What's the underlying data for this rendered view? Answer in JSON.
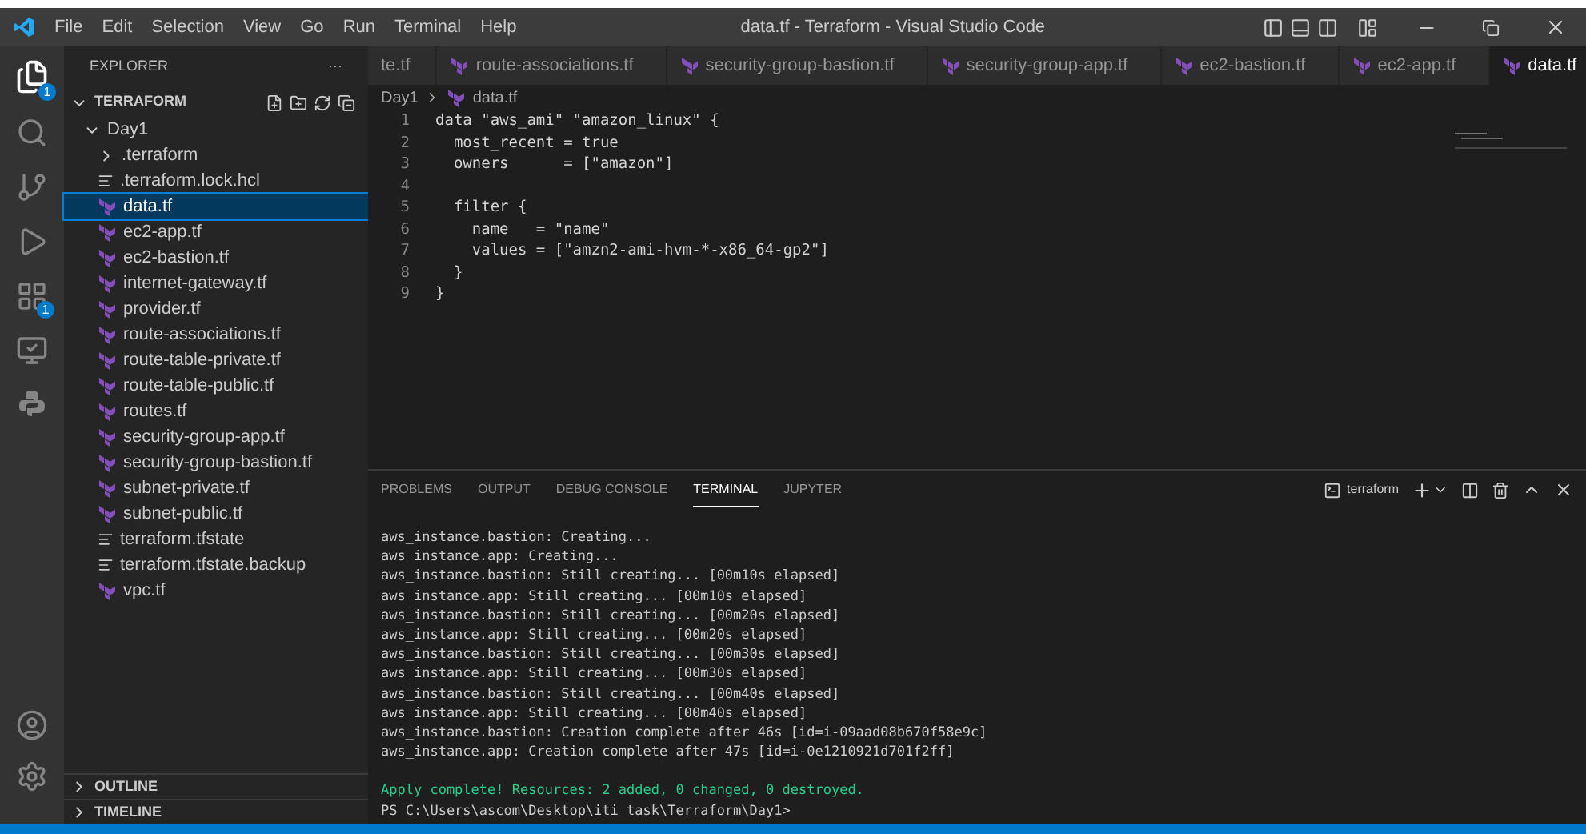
{
  "window": {
    "title": "data.tf - Terraform - Visual Studio Code"
  },
  "menu": [
    "File",
    "Edit",
    "Selection",
    "View",
    "Go",
    "Run",
    "Terminal",
    "Help"
  ],
  "activity_badges": {
    "explorer": "1",
    "extensions": "1"
  },
  "sidebar": {
    "title": "EXPLORER",
    "more": "···",
    "root": {
      "label": "TERRAFORM",
      "expanded": true,
      "children": [
        {
          "label": "Day1",
          "kind": "folder",
          "expanded": true,
          "selected": false,
          "children": [
            {
              "label": ".terraform",
              "kind": "folder",
              "expanded": false,
              "selected": false
            },
            {
              "label": ".terraform.lock.hcl",
              "kind": "text",
              "selected": false
            },
            {
              "label": "data.tf",
              "kind": "tf",
              "selected": true
            },
            {
              "label": "ec2-app.tf",
              "kind": "tf",
              "selected": false
            },
            {
              "label": "ec2-bastion.tf",
              "kind": "tf",
              "selected": false
            },
            {
              "label": "internet-gateway.tf",
              "kind": "tf",
              "selected": false
            },
            {
              "label": "provider.tf",
              "kind": "tf",
              "selected": false
            },
            {
              "label": "route-associations.tf",
              "kind": "tf",
              "selected": false
            },
            {
              "label": "route-table-private.tf",
              "kind": "tf",
              "selected": false
            },
            {
              "label": "route-table-public.tf",
              "kind": "tf",
              "selected": false
            },
            {
              "label": "routes.tf",
              "kind": "tf",
              "selected": false
            },
            {
              "label": "security-group-app.tf",
              "kind": "tf",
              "selected": false
            },
            {
              "label": "security-group-bastion.tf",
              "kind": "tf",
              "selected": false
            },
            {
              "label": "subnet-private.tf",
              "kind": "tf",
              "selected": false
            },
            {
              "label": "subnet-public.tf",
              "kind": "tf",
              "selected": false
            },
            {
              "label": "terraform.tfstate",
              "kind": "text",
              "selected": false
            },
            {
              "label": "terraform.tfstate.backup",
              "kind": "text",
              "selected": false
            },
            {
              "label": "vpc.tf",
              "kind": "tf",
              "selected": false
            }
          ]
        }
      ]
    },
    "sections": [
      {
        "label": "OUTLINE",
        "expanded": false
      },
      {
        "label": "TIMELINE",
        "expanded": false
      }
    ]
  },
  "tabs": [
    {
      "label": "te.tf",
      "selected": false,
      "kind": "plain"
    },
    {
      "label": "route-associations.tf",
      "selected": false,
      "kind": "tf"
    },
    {
      "label": "security-group-bastion.tf",
      "selected": false,
      "kind": "tf"
    },
    {
      "label": "security-group-app.tf",
      "selected": false,
      "kind": "tf"
    },
    {
      "label": "ec2-bastion.tf",
      "selected": false,
      "kind": "tf"
    },
    {
      "label": "ec2-app.tf",
      "selected": false,
      "kind": "tf"
    },
    {
      "label": "data.tf",
      "selected": true,
      "kind": "tf"
    }
  ],
  "breadcrumb": [
    "Day1",
    "data.tf"
  ],
  "code": [
    {
      "line": "1",
      "text": "data \"aws_ami\" \"amazon_linux\" {"
    },
    {
      "line": "2",
      "text": "  most_recent = true"
    },
    {
      "line": "3",
      "text": "  owners      = [\"amazon\"]"
    },
    {
      "line": "4"
    },
    {
      "line": "5",
      "text": "  filter {"
    },
    {
      "line": "6",
      "text": "    name   = \"name\""
    },
    {
      "line": "7",
      "text": "    values = [\"amzn2-ami-hvm-*-x86_64-gp2\"]"
    },
    {
      "line": "8",
      "text": "  }"
    },
    {
      "line": "9",
      "text": "}"
    }
  ],
  "panel": {
    "tabs": [
      {
        "label": "PROBLEMS",
        "selected": false
      },
      {
        "label": "OUTPUT",
        "selected": false
      },
      {
        "label": "DEBUG CONSOLE",
        "selected": false
      },
      {
        "label": "TERMINAL",
        "selected": true
      },
      {
        "label": "JUPYTER",
        "selected": false
      }
    ],
    "terminal_name": "terraform",
    "lines": [
      {
        "kind": "normal",
        "text": "aws_instance.bastion: Creating..."
      },
      {
        "kind": "normal",
        "text": "aws_instance.app: Creating..."
      },
      {
        "kind": "normal",
        "text": "aws_instance.bastion: Still creating... [00m10s elapsed]"
      },
      {
        "kind": "normal",
        "text": "aws_instance.app: Still creating... [00m10s elapsed]"
      },
      {
        "kind": "normal",
        "text": "aws_instance.bastion: Still creating... [00m20s elapsed]"
      },
      {
        "kind": "normal",
        "text": "aws_instance.app: Still creating... [00m20s elapsed]"
      },
      {
        "kind": "normal",
        "text": "aws_instance.bastion: Still creating... [00m30s elapsed]"
      },
      {
        "kind": "normal",
        "text": "aws_instance.app: Still creating... [00m30s elapsed]"
      },
      {
        "kind": "normal",
        "text": "aws_instance.bastion: Still creating... [00m40s elapsed]"
      },
      {
        "kind": "normal",
        "text": "aws_instance.app: Still creating... [00m40s elapsed]"
      },
      {
        "kind": "normal",
        "text": "aws_instance.bastion: Creation complete after 46s [id=i-09aad08b670f58e9c]"
      },
      {
        "kind": "normal",
        "text": "aws_instance.app: Creation complete after 47s [id=i-0e1210921d701f2ff]"
      },
      {
        "kind": "blank"
      },
      {
        "kind": "success",
        "text": "Apply complete! Resources: 2 added, 0 changed, 0 destroyed."
      },
      {
        "kind": "normal",
        "text": "PS C:\\Users\\ascom\\Desktop\\iti task\\Terraform\\Day1>"
      }
    ]
  }
}
